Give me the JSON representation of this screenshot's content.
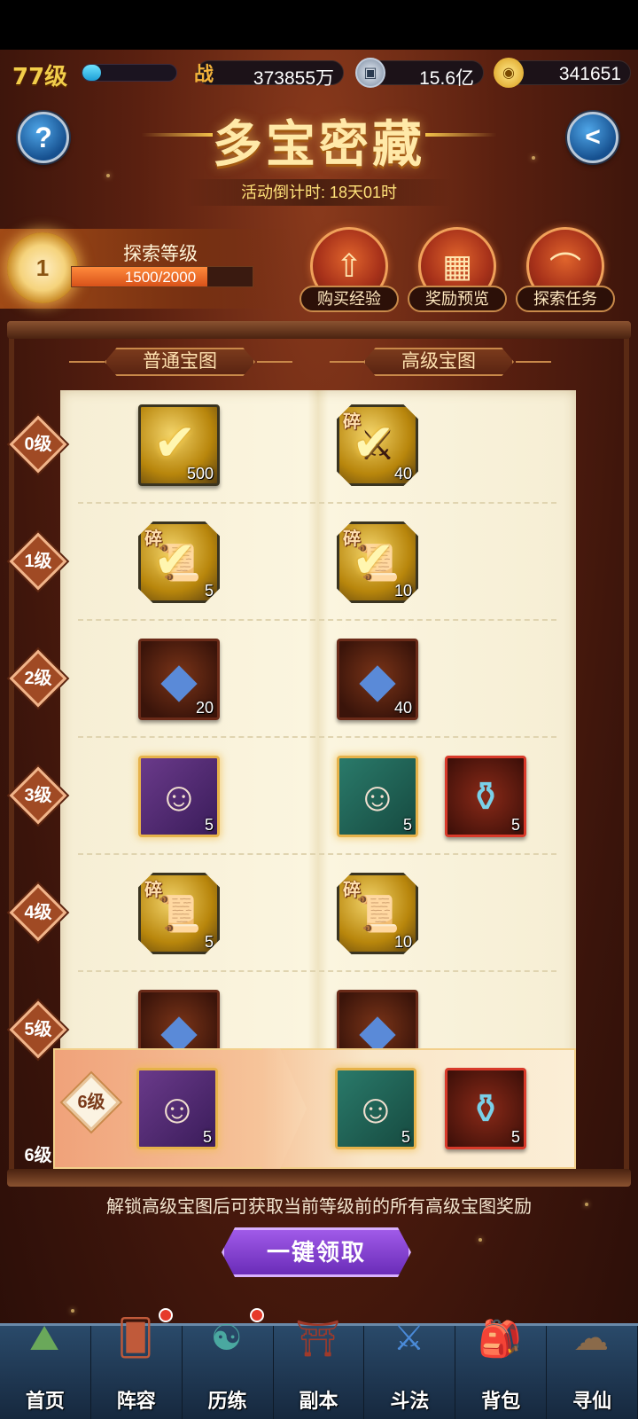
{
  "top_bar": {
    "level_text": "77级",
    "level_progress": 0.2,
    "combat_icon": "战",
    "combat_value": "373855万",
    "coin_value": "15.6亿",
    "gold_value": "341651"
  },
  "header": {
    "title": "多宝密藏",
    "countdown": "活动倒计时: 18天01时"
  },
  "explore": {
    "level": "1",
    "label": "探索等级",
    "progress_text": "1500/2000",
    "progress": 0.75
  },
  "actions": [
    {
      "label": "购买经验",
      "icon": "level-up-icon"
    },
    {
      "label": "奖励预览",
      "icon": "chest-icon"
    },
    {
      "label": "探索任务",
      "icon": "scroll-icon"
    }
  ],
  "tabs": {
    "normal": "普通宝图",
    "advanced": "高级宝图"
  },
  "rows": [
    {
      "level": "0级",
      "normal": [
        {
          "type": "gold",
          "count": "500",
          "claimed": true
        }
      ],
      "advanced": [
        {
          "type": "frag-weapon",
          "count": "40",
          "claimed": true,
          "frag": "碎"
        }
      ]
    },
    {
      "level": "1级",
      "normal": [
        {
          "type": "frag-scroll",
          "count": "5",
          "claimed": true,
          "frag": "碎"
        }
      ],
      "advanced": [
        {
          "type": "frag-scroll",
          "count": "10",
          "claimed": true,
          "frag": "碎"
        }
      ]
    },
    {
      "level": "2级",
      "normal": [
        {
          "type": "crystal",
          "count": "20"
        }
      ],
      "advanced": [
        {
          "type": "crystal",
          "count": "40"
        }
      ]
    },
    {
      "level": "3级",
      "normal": [
        {
          "type": "hero-purple",
          "count": "5"
        }
      ],
      "advanced": [
        {
          "type": "hero-teal",
          "count": "5"
        },
        {
          "type": "potion",
          "count": "5"
        }
      ]
    },
    {
      "level": "4级",
      "normal": [
        {
          "type": "frag-scroll",
          "count": "5",
          "frag": "碎"
        }
      ],
      "advanced": [
        {
          "type": "frag-scroll",
          "count": "10",
          "frag": "碎"
        }
      ]
    },
    {
      "level": "5级",
      "normal": [
        {
          "type": "crystal",
          "count": ""
        }
      ],
      "advanced": [
        {
          "type": "crystal",
          "count": ""
        }
      ]
    }
  ],
  "highlight_row": {
    "level": "6级",
    "normal": [
      {
        "type": "hero-purple",
        "count": "5"
      }
    ],
    "advanced": [
      {
        "type": "hero-teal",
        "count": "5"
      },
      {
        "type": "potion",
        "count": "5"
      }
    ]
  },
  "partial_level": "6级",
  "notice": "解锁高级宝图后可获取当前等级前的所有高级宝图奖励",
  "claim_button": "一键领取",
  "nav": [
    {
      "label": "首页",
      "icon": "home-icon",
      "dot": false
    },
    {
      "label": "阵容",
      "icon": "lineup-icon",
      "dot": true
    },
    {
      "label": "历练",
      "icon": "training-icon",
      "dot": true
    },
    {
      "label": "副本",
      "icon": "dungeon-icon",
      "dot": false
    },
    {
      "label": "斗法",
      "icon": "battle-icon",
      "dot": false
    },
    {
      "label": "背包",
      "icon": "bag-icon",
      "dot": false
    },
    {
      "label": "寻仙",
      "icon": "seek-icon",
      "dot": false
    }
  ]
}
